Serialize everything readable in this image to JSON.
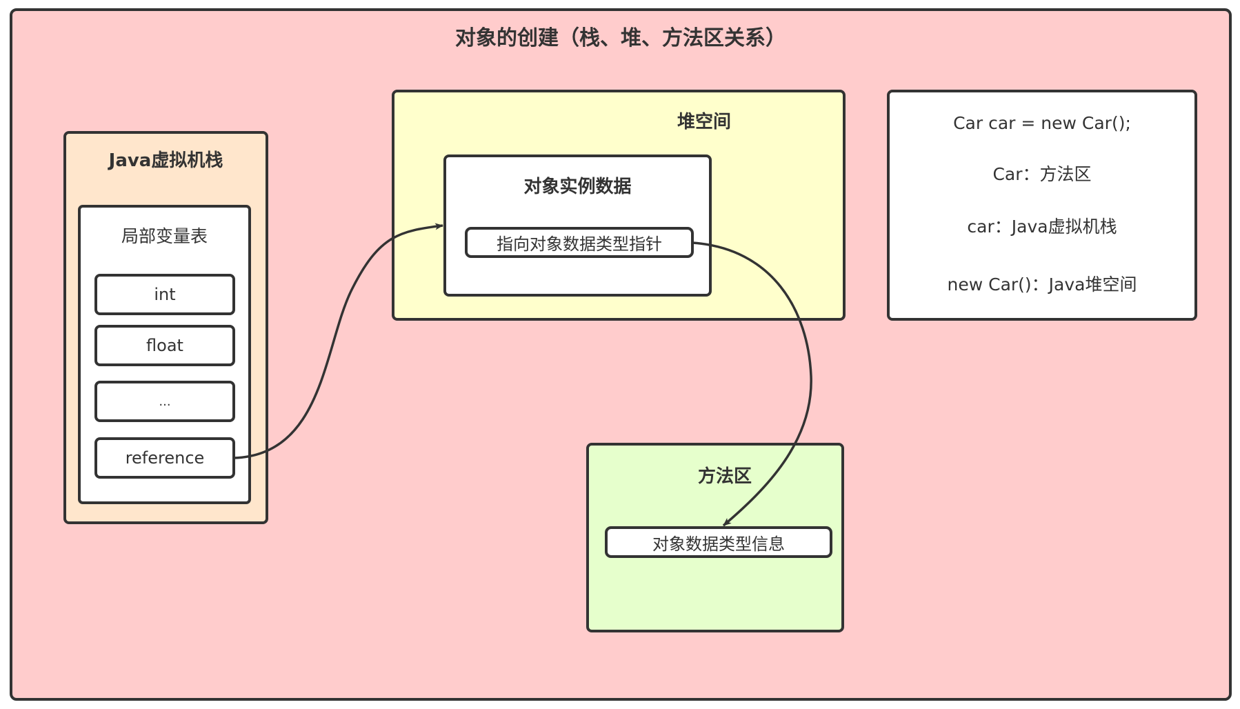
{
  "diagram": {
    "title": "对象的创建（栈、堆、方法区关系）",
    "colors": {
      "canvas": "#ffcccc",
      "stack": "#ffe6cc",
      "heap": "#ffffcc",
      "method_area": "#e6ffcc",
      "box": "#ffffff",
      "stroke": "#333333"
    },
    "stack": {
      "title": "Java虚拟机栈",
      "local_variable_table": {
        "title": "局部变量表",
        "slots": [
          "int",
          "float",
          "...",
          "reference"
        ]
      }
    },
    "heap": {
      "title": "堆空间",
      "instance": {
        "title": "对象实例数据",
        "pointer": "指向对象数据类型指针"
      }
    },
    "method_area": {
      "title": "方法区",
      "type_info": "对象数据类型信息"
    },
    "notes": [
      "Car car = new Car();",
      "Car：方法区",
      "car：Java虚拟机栈",
      "new Car()：Java堆空间"
    ],
    "edges": [
      {
        "from": "reference",
        "to": "对象实例数据",
        "arrow": "end"
      },
      {
        "from": "指向对象数据类型指针",
        "to": "对象数据类型信息",
        "arrow": "end"
      }
    ]
  }
}
